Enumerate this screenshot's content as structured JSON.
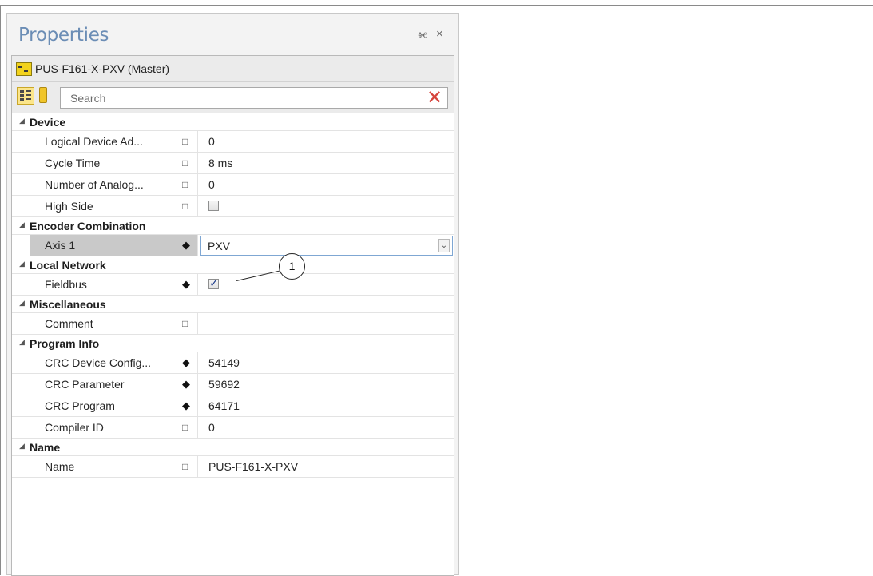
{
  "panel": {
    "title": "Properties",
    "pin_glyph": "Ȩ",
    "close_glyph": "×",
    "object_name": "PUS-F161-X-PXV (Master)",
    "search": {
      "placeholder": "Search",
      "value": ""
    }
  },
  "groups": [
    {
      "label": "Device",
      "rows": [
        {
          "name": "Logical Device Ad...",
          "marker": "square",
          "value": "0"
        },
        {
          "name": "Cycle Time",
          "marker": "square",
          "value": "8 ms"
        },
        {
          "name": "Number of Analog...",
          "marker": "square",
          "value": "0"
        },
        {
          "name": "High Side",
          "marker": "square",
          "checkbox": false
        }
      ]
    },
    {
      "label": "Encoder Combination",
      "rows": [
        {
          "name": "Axis 1",
          "marker": "diamond",
          "dropdown": "PXV",
          "selected": true
        }
      ]
    },
    {
      "label": "Local Network",
      "rows": [
        {
          "name": "Fieldbus",
          "marker": "diamond",
          "checkbox": true
        }
      ]
    },
    {
      "label": "Miscellaneous",
      "rows": [
        {
          "name": "Comment",
          "marker": "square",
          "value": ""
        }
      ]
    },
    {
      "label": "Program Info",
      "rows": [
        {
          "name": "CRC Device Config...",
          "marker": "diamond",
          "value": "54149"
        },
        {
          "name": "CRC Parameter",
          "marker": "diamond",
          "value": "59692"
        },
        {
          "name": "CRC Program",
          "marker": "diamond",
          "value": "64171"
        },
        {
          "name": "Compiler ID",
          "marker": "square",
          "value": "0"
        }
      ]
    },
    {
      "label": "Name",
      "rows": [
        {
          "name": "Name",
          "marker": "square",
          "value": "PUS-F161-X-PXV"
        }
      ]
    }
  ],
  "callout": {
    "number": "1"
  },
  "colors": {
    "title": "#6b8db5",
    "search_clear": "#d6443c",
    "selected_row": "#c9c9c9",
    "accent_border": "#7fa7d3"
  }
}
